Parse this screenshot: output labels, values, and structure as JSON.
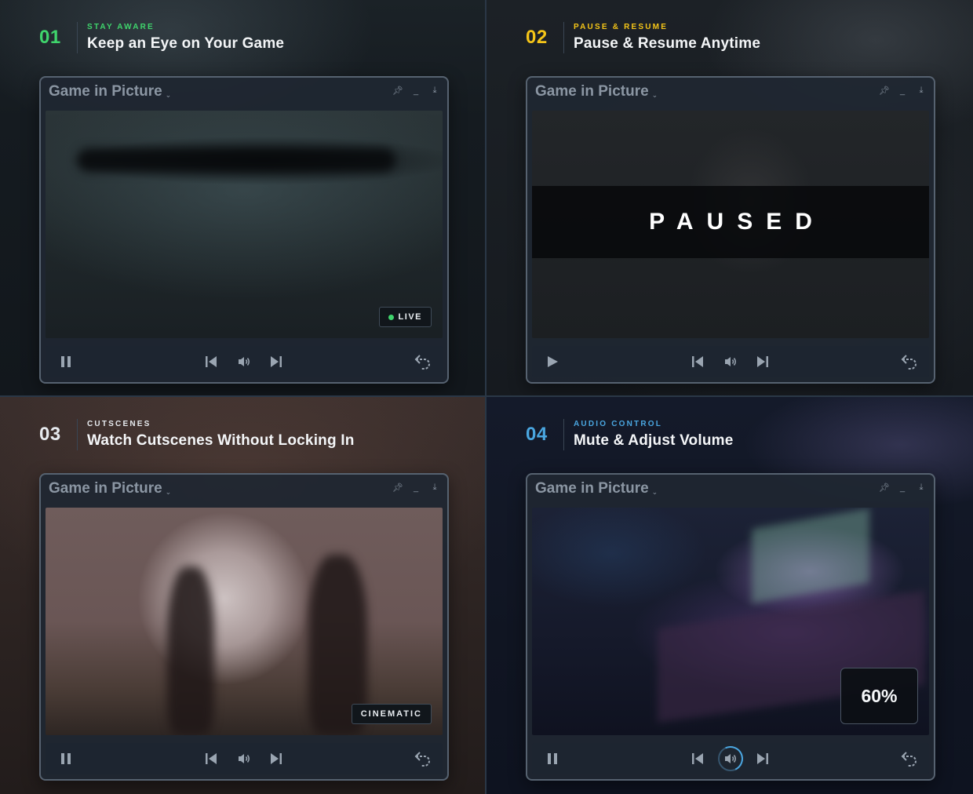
{
  "colors": {
    "num_green": "#3fd46c",
    "num_yellow": "#f5c518",
    "num_white": "#e6eaee",
    "num_blue": "#4aa6e0"
  },
  "panels": [
    {
      "number": "01",
      "kicker": "STAY AWARE",
      "title": "Keep an Eye on Your Game",
      "window": {
        "title": "Game in Picture",
        "badge": "LIVE"
      }
    },
    {
      "number": "02",
      "kicker": "PAUSE & RESUME",
      "title": "Pause & Resume Anytime",
      "window": {
        "title": "Game in Picture",
        "overlay": "PAUSED"
      }
    },
    {
      "number": "03",
      "kicker": "CUTSCENES",
      "title": "Watch Cutscenes Without Locking In",
      "window": {
        "title": "Game in Picture",
        "badge": "CINEMATIC"
      }
    },
    {
      "number": "04",
      "kicker": "AUDIO CONTROL",
      "title": "Mute & Adjust Volume",
      "window": {
        "title": "Game in Picture",
        "volume": "60%"
      }
    }
  ],
  "icons": {
    "pause": "pause-icon",
    "play": "play-icon",
    "prev": "skip-previous-icon",
    "volume": "volume-icon",
    "next": "skip-next-icon",
    "return": "return-to-game-icon",
    "pin": "pin-icon",
    "minimize": "minimize-icon",
    "download": "download-icon",
    "caret": "chevron-down-icon"
  }
}
